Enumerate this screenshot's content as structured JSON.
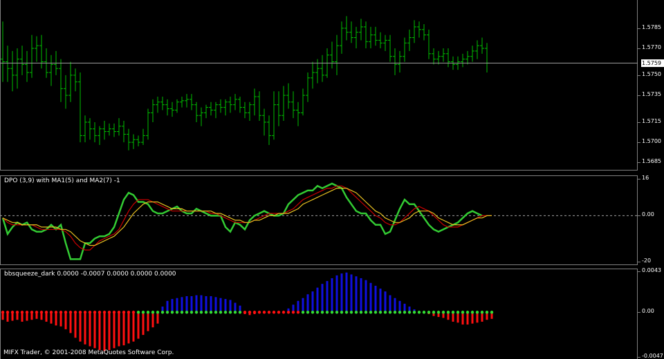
{
  "chart_data": [
    {
      "type": "ohlc",
      "pane": "price",
      "color": "#00c000",
      "ylim": [
        1.568,
        1.5805
      ],
      "y_ticks": [
        "1.5785",
        "1.5770",
        "1.5750",
        "1.5735",
        "1.5715",
        "1.5700",
        "1.5685"
      ],
      "current_price": "1.5759",
      "bars": [
        [
          1.5762,
          1.579,
          1.5745,
          1.576
        ],
        [
          1.576,
          1.5772,
          1.5745,
          1.5755
        ],
        [
          1.5755,
          1.5768,
          1.5738,
          1.575
        ],
        [
          1.575,
          1.577,
          1.574,
          1.5762
        ],
        [
          1.5762,
          1.5772,
          1.575,
          1.5758
        ],
        [
          1.5758,
          1.5768,
          1.5745,
          1.5752
        ],
        [
          1.5752,
          1.578,
          1.5748,
          1.577
        ],
        [
          1.577,
          1.5779,
          1.576,
          1.5772
        ],
        [
          1.5772,
          1.578,
          1.5755,
          1.576
        ],
        [
          1.576,
          1.577,
          1.5748,
          1.5752
        ],
        [
          1.5752,
          1.5765,
          1.5742,
          1.5758
        ],
        [
          1.5758,
          1.5768,
          1.575,
          1.5755
        ],
        [
          1.5755,
          1.5762,
          1.573,
          1.574
        ],
        [
          1.574,
          1.575,
          1.5725,
          1.5735
        ],
        [
          1.5735,
          1.576,
          1.573,
          1.575
        ],
        [
          1.575,
          1.5755,
          1.5738,
          1.5745
        ],
        [
          1.5745,
          1.5752,
          1.57,
          1.5705
        ],
        [
          1.5705,
          1.572,
          1.57,
          1.5715
        ],
        [
          1.5715,
          1.5718,
          1.5702,
          1.571
        ],
        [
          1.571,
          1.5715,
          1.57,
          1.5705
        ],
        [
          1.5705,
          1.5712,
          1.5698,
          1.571
        ],
        [
          1.571,
          1.5716,
          1.5702,
          1.5708
        ],
        [
          1.5708,
          1.5714,
          1.5705,
          1.571
        ],
        [
          1.571,
          1.5714,
          1.5704,
          1.5708
        ],
        [
          1.5708,
          1.5718,
          1.5705,
          1.5712
        ],
        [
          1.5712,
          1.5716,
          1.57,
          1.5706
        ],
        [
          1.5706,
          1.571,
          1.5694,
          1.57
        ],
        [
          1.57,
          1.5706,
          1.5695,
          1.5702
        ],
        [
          1.5702,
          1.5705,
          1.5697,
          1.57
        ],
        [
          1.57,
          1.571,
          1.5698,
          1.5705
        ],
        [
          1.5705,
          1.5725,
          1.5702,
          1.5722
        ],
        [
          1.5722,
          1.5732,
          1.5715,
          1.5728
        ],
        [
          1.5728,
          1.5734,
          1.5722,
          1.573
        ],
        [
          1.573,
          1.5734,
          1.5724,
          1.5728
        ],
        [
          1.5728,
          1.5732,
          1.572,
          1.5725
        ],
        [
          1.5725,
          1.573,
          1.5719,
          1.5724
        ],
        [
          1.5724,
          1.5732,
          1.5722,
          1.573
        ],
        [
          1.573,
          1.5734,
          1.5726,
          1.5731
        ],
        [
          1.5731,
          1.5736,
          1.5726,
          1.5732
        ],
        [
          1.5732,
          1.5736,
          1.5724,
          1.5728
        ],
        [
          1.5728,
          1.573,
          1.5715,
          1.572
        ],
        [
          1.572,
          1.5726,
          1.5712,
          1.5722
        ],
        [
          1.5722,
          1.5728,
          1.5718,
          1.5726
        ],
        [
          1.5726,
          1.573,
          1.572,
          1.5724
        ],
        [
          1.5724,
          1.573,
          1.5718,
          1.5728
        ],
        [
          1.5728,
          1.5732,
          1.5722,
          1.5726
        ],
        [
          1.5726,
          1.5732,
          1.572,
          1.573
        ],
        [
          1.573,
          1.5734,
          1.5722,
          1.5728
        ],
        [
          1.5728,
          1.5736,
          1.5724,
          1.5732
        ],
        [
          1.5732,
          1.5734,
          1.5722,
          1.5726
        ],
        [
          1.5726,
          1.573,
          1.5718,
          1.5722
        ],
        [
          1.5722,
          1.573,
          1.5716,
          1.5728
        ],
        [
          1.5728,
          1.574,
          1.572,
          1.5734
        ],
        [
          1.5734,
          1.5738,
          1.5716,
          1.572
        ],
        [
          1.572,
          1.5725,
          1.5705,
          1.5715
        ],
        [
          1.5715,
          1.572,
          1.5698,
          1.5705
        ],
        [
          1.5705,
          1.5738,
          1.5702,
          1.5728
        ],
        [
          1.5728,
          1.5738,
          1.5712,
          1.572
        ],
        [
          1.572,
          1.5742,
          1.5716,
          1.5735
        ],
        [
          1.5735,
          1.5744,
          1.5725,
          1.573
        ],
        [
          1.573,
          1.5738,
          1.5718,
          1.5724
        ],
        [
          1.5724,
          1.573,
          1.5712,
          1.5722
        ],
        [
          1.5722,
          1.574,
          1.572,
          1.5735
        ],
        [
          1.5735,
          1.5752,
          1.573,
          1.5748
        ],
        [
          1.5748,
          1.576,
          1.574,
          1.5752
        ],
        [
          1.5752,
          1.5762,
          1.5744,
          1.5755
        ],
        [
          1.5755,
          1.5765,
          1.5745,
          1.575
        ],
        [
          1.575,
          1.577,
          1.5748,
          1.5765
        ],
        [
          1.5765,
          1.5775,
          1.5755,
          1.576
        ],
        [
          1.576,
          1.578,
          1.575,
          1.5772
        ],
        [
          1.5772,
          1.579,
          1.5766,
          1.5785
        ],
        [
          1.5785,
          1.5794,
          1.5776,
          1.5782
        ],
        [
          1.5782,
          1.579,
          1.5774,
          1.5778
        ],
        [
          1.5778,
          1.5786,
          1.577,
          1.5782
        ],
        [
          1.5782,
          1.5792,
          1.5776,
          1.5786
        ],
        [
          1.5786,
          1.579,
          1.577,
          1.5775
        ],
        [
          1.5775,
          1.5786,
          1.577,
          1.578
        ],
        [
          1.578,
          1.5786,
          1.5772,
          1.5776
        ],
        [
          1.5776,
          1.5782,
          1.577,
          1.5774
        ],
        [
          1.5774,
          1.578,
          1.5768,
          1.5776
        ],
        [
          1.5776,
          1.578,
          1.576,
          1.5764
        ],
        [
          1.5764,
          1.577,
          1.575,
          1.5758
        ],
        [
          1.5758,
          1.5768,
          1.5752,
          1.5764
        ],
        [
          1.5764,
          1.5778,
          1.576,
          1.5774
        ],
        [
          1.5774,
          1.5784,
          1.5768,
          1.5778
        ],
        [
          1.5778,
          1.5791,
          1.5774,
          1.5786
        ],
        [
          1.5786,
          1.579,
          1.5778,
          1.5784
        ],
        [
          1.5784,
          1.5788,
          1.5776,
          1.578
        ],
        [
          1.578,
          1.5784,
          1.5762,
          1.5766
        ],
        [
          1.5766,
          1.577,
          1.5758,
          1.5762
        ],
        [
          1.5762,
          1.5768,
          1.5758,
          1.5764
        ],
        [
          1.5764,
          1.577,
          1.576,
          1.5766
        ],
        [
          1.5766,
          1.577,
          1.5756,
          1.576
        ],
        [
          1.576,
          1.5764,
          1.5754,
          1.5758
        ],
        [
          1.5758,
          1.5764,
          1.5754,
          1.576
        ],
        [
          1.576,
          1.5766,
          1.5756,
          1.5762
        ],
        [
          1.5762,
          1.5768,
          1.5758,
          1.5764
        ],
        [
          1.5764,
          1.5772,
          1.576,
          1.5768
        ],
        [
          1.5768,
          1.5776,
          1.5762,
          1.5772
        ],
        [
          1.5772,
          1.5778,
          1.5766,
          1.577
        ],
        [
          1.577,
          1.5774,
          1.5752,
          1.5759
        ]
      ]
    },
    {
      "type": "line",
      "pane": "dpo",
      "title": "DPO (3,9) with MA1(5) and MA2(7) -1",
      "ylim": [
        -21,
        17
      ],
      "y_ticks": [
        "16",
        "0.00",
        "-20"
      ],
      "zero_line": 0,
      "series": [
        {
          "color": "#33cc33",
          "values": [
            -1,
            -8,
            -5,
            -3,
            -4,
            -3,
            -6,
            -7,
            -7,
            -6,
            -4,
            -6,
            -4,
            -12,
            -19,
            -19,
            -19,
            -12,
            -12,
            -10,
            -9,
            -9,
            -8,
            -5,
            1,
            7,
            10,
            9,
            6,
            6,
            5,
            2,
            1,
            1,
            2,
            3,
            4,
            2,
            1,
            1,
            3,
            2,
            1,
            0,
            0,
            0,
            -5,
            -7,
            -3,
            -4,
            -6,
            -2,
            0,
            1,
            2,
            1,
            0,
            0,
            1,
            5,
            7,
            9,
            10,
            11,
            11,
            13,
            12,
            13,
            14,
            13,
            12,
            8,
            5,
            2,
            1,
            1,
            -2,
            -4,
            -4,
            -8,
            -7,
            -2,
            3,
            7,
            5,
            5,
            2,
            -1,
            -4,
            -6,
            -7,
            -6,
            -5,
            -4,
            -3,
            -1,
            1,
            2,
            1,
            0
          ]
        },
        {
          "color": "#cc0000",
          "values": [
            -1,
            -3,
            -4,
            -4,
            -4,
            -4,
            -4,
            -5,
            -6,
            -6,
            -6,
            -6,
            -6,
            -7,
            -9,
            -12,
            -14,
            -15,
            -15,
            -13,
            -11,
            -10,
            -9,
            -8,
            -6,
            -2,
            2,
            5,
            7,
            7,
            7,
            6,
            5,
            4,
            3,
            2,
            2,
            2,
            2,
            2,
            2,
            2,
            2,
            1,
            1,
            0,
            -1,
            -2,
            -3,
            -3,
            -3,
            -3,
            -2,
            -1,
            0,
            1,
            1,
            1,
            1,
            2,
            3,
            5,
            7,
            8,
            9,
            10,
            11,
            12,
            12,
            13,
            13,
            12,
            10,
            8,
            6,
            4,
            2,
            0,
            -1,
            -3,
            -4,
            -4,
            -3,
            -1,
            1,
            3,
            4,
            3,
            2,
            0,
            -2,
            -4,
            -5,
            -5,
            -5,
            -4,
            -3,
            -2,
            -1,
            0,
            0,
            0
          ]
        },
        {
          "color": "#e8c020",
          "values": [
            -1,
            -2,
            -3,
            -3,
            -4,
            -4,
            -4,
            -4,
            -5,
            -5,
            -5,
            -5,
            -6,
            -6,
            -7,
            -9,
            -11,
            -12,
            -13,
            -13,
            -12,
            -11,
            -10,
            -9,
            -7,
            -5,
            -2,
            1,
            3,
            5,
            6,
            6,
            6,
            5,
            4,
            3,
            3,
            3,
            2,
            2,
            2,
            2,
            2,
            2,
            1,
            1,
            0,
            -1,
            -2,
            -2,
            -3,
            -3,
            -2,
            -2,
            -1,
            0,
            0,
            1,
            1,
            1,
            2,
            3,
            5,
            6,
            7,
            8,
            9,
            10,
            11,
            12,
            12,
            12,
            11,
            10,
            8,
            6,
            4,
            2,
            1,
            -1,
            -2,
            -3,
            -3,
            -2,
            -1,
            1,
            2,
            2,
            2,
            1,
            -1,
            -2,
            -3,
            -4,
            -4,
            -4,
            -3,
            -2,
            -1,
            -1,
            0,
            0
          ]
        }
      ]
    },
    {
      "type": "bar",
      "pane": "bbsqueeze",
      "title": "bbsqueeze_dark 0.0000 -0.0007 0.0000 0.0000 0.0000",
      "ylim": [
        -0.0048,
        0.0044
      ],
      "y_ticks": [
        "0.0043",
        "0.00",
        "-0.0047"
      ],
      "positive_color": "#1010e0",
      "negative_color": "#ff1010",
      "values": [
        -0.0008,
        -0.001,
        -0.0009,
        -0.0008,
        -0.001,
        -0.0009,
        -0.0008,
        -0.0007,
        -0.0008,
        -0.001,
        -0.0012,
        -0.0014,
        -0.0015,
        -0.0018,
        -0.0022,
        -0.0027,
        -0.0031,
        -0.0034,
        -0.0036,
        -0.0038,
        -0.004,
        -0.0041,
        -0.004,
        -0.0038,
        -0.0036,
        -0.0035,
        -0.0033,
        -0.0031,
        -0.0028,
        -0.0024,
        -0.002,
        -0.0016,
        -0.0012,
        0.0006,
        0.0012,
        0.0014,
        0.0015,
        0.0016,
        0.0017,
        0.0017,
        0.0018,
        0.0018,
        0.0017,
        0.0017,
        0.0016,
        0.0015,
        0.0014,
        0.0013,
        0.001,
        0.0007,
        -0.0002,
        -0.0003,
        -0.0002,
        -0.0001,
        -0.0001,
        -0.0001,
        -0.0001,
        -0.0001,
        0.0001,
        0.0004,
        0.0008,
        0.0012,
        0.0015,
        0.0019,
        0.0022,
        0.0026,
        0.003,
        0.0033,
        0.0036,
        0.0039,
        0.0041,
        0.0042,
        0.004,
        0.0038,
        0.0036,
        0.0034,
        0.0031,
        0.0028,
        0.0025,
        0.0022,
        0.0018,
        0.0015,
        0.0012,
        0.0009,
        0.0006,
        0.0003,
        0.0001,
        -0.0001,
        -0.0002,
        -0.0004,
        -0.0005,
        -0.0006,
        -0.0008,
        -0.001,
        -0.0011,
        -0.0013,
        -0.0013,
        -0.0012,
        -0.0011,
        -0.001,
        -0.0008,
        -0.0007
      ],
      "dots": {
        "green_color": "#33dd33",
        "red_color": "#ff1010",
        "pattern": [
          "r",
          "r",
          "r",
          "r",
          "r",
          "r",
          "r",
          "r",
          "r",
          "r",
          "r",
          "r",
          "r",
          "r",
          "r",
          "r",
          "r",
          "r",
          "r",
          "r",
          "r",
          "r",
          "r",
          "r",
          "r",
          "r",
          "r",
          "r",
          "g",
          "g",
          "g",
          "g",
          "g",
          "g",
          "g",
          "g",
          "g",
          "g",
          "g",
          "g",
          "g",
          "g",
          "g",
          "g",
          "g",
          "g",
          "g",
          "g",
          "g",
          "g",
          "r",
          "r",
          "r",
          "r",
          "r",
          "r",
          "r",
          "r",
          "r",
          "r",
          "r",
          "r",
          "g",
          "g",
          "g",
          "g",
          "g",
          "g",
          "g",
          "g",
          "g",
          "g",
          "g",
          "g",
          "g",
          "g",
          "g",
          "g",
          "g",
          "g",
          "g",
          "g",
          "g",
          "g",
          "g",
          "g",
          "g",
          "g",
          "g",
          "g",
          "g",
          "g",
          "g",
          "g",
          "g",
          "g",
          "g",
          "g",
          "g",
          "g",
          "g",
          "g",
          "g"
        ]
      }
    }
  ],
  "footer": {
    "copyright": "MIFX Trader, © 2001-2008 MetaQuotes Software Corp."
  }
}
